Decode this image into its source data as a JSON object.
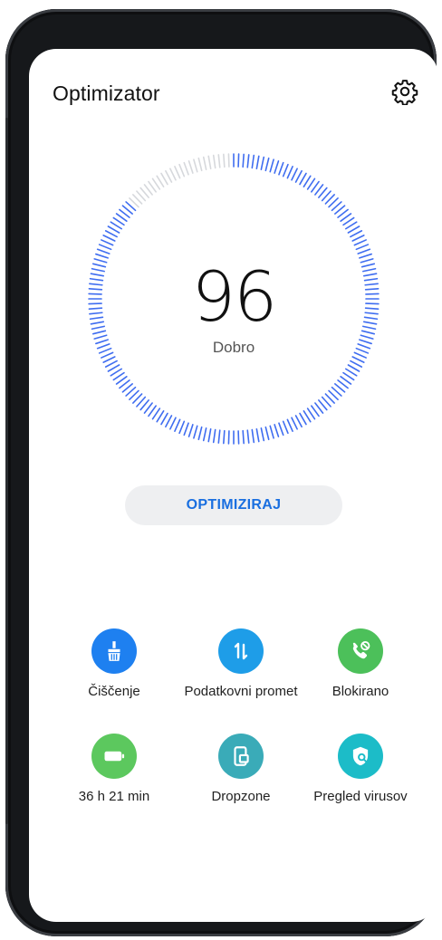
{
  "app": {
    "title": "Optimizator"
  },
  "score": {
    "value": "96",
    "label": "Dobro",
    "level": 0.96
  },
  "optimize_button": {
    "label": "OPTIMIZIRAJ"
  },
  "tools": [
    {
      "label": "Čiščenje",
      "icon": "broom-icon",
      "color": "#1e80f0"
    },
    {
      "label": "Podatkovni promet",
      "icon": "data-transfer-icon",
      "color": "#1e9de8"
    },
    {
      "label": "Blokirano",
      "icon": "blocked-call-icon",
      "color": "#4cc05a"
    },
    {
      "label": "36 h 21 min",
      "icon": "battery-icon",
      "color": "#5cc85e"
    },
    {
      "label": "Dropzone",
      "icon": "dropzone-icon",
      "color": "#3aabb8"
    },
    {
      "label": "Pregled virusov",
      "icon": "virus-scan-icon",
      "color": "#1cbcc8"
    }
  ],
  "colors": {
    "accent": "#1a6fe0",
    "gauge": "#3f6df0",
    "gauge_inactive": "#d6d8dc"
  }
}
